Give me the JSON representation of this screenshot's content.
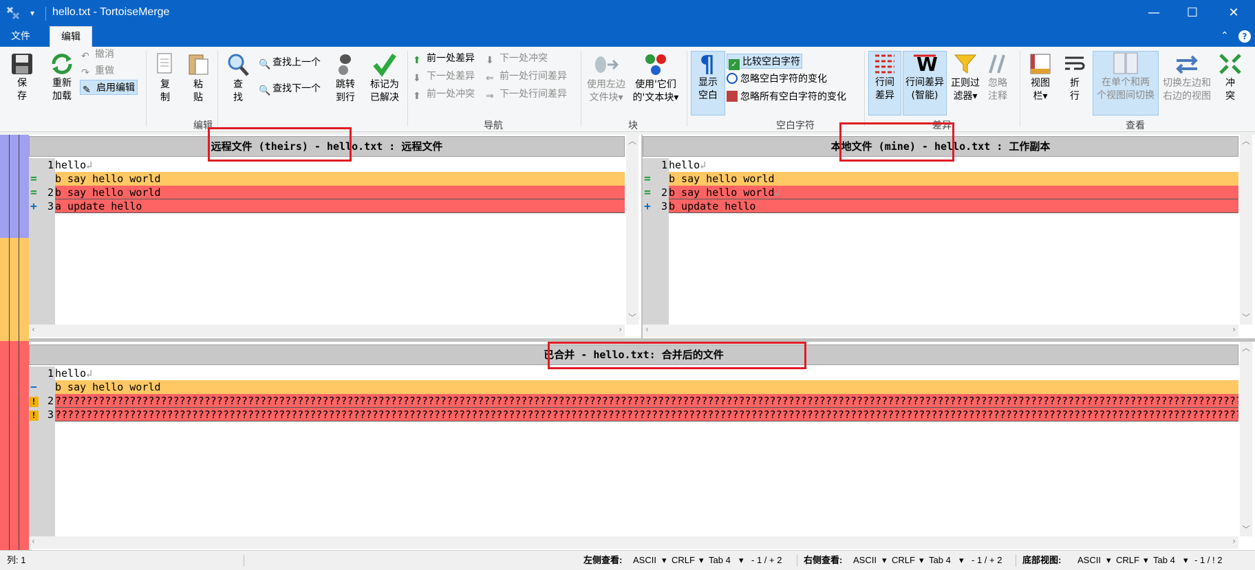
{
  "window": {
    "title": "hello.txt - TortoiseMerge",
    "minimize": "—",
    "maximize": "☐",
    "close": "✕"
  },
  "menu": {
    "file": "文件",
    "edit": "编辑"
  },
  "ribbon": {
    "edit_group": {
      "label": "编辑",
      "save": [
        "保",
        "存"
      ],
      "reload": [
        "重新",
        "加载"
      ],
      "undo": "撤消",
      "redo": "重做",
      "enable_edit": "启用编辑",
      "copy": [
        "复",
        "制"
      ],
      "paste": [
        "粘",
        "贴"
      ],
      "find": [
        "查",
        "找"
      ],
      "find_prev": "查找上一个",
      "find_next": "查找下一个",
      "goto_line": [
        "跳转",
        "到行"
      ],
      "mark_resolved": [
        "标记为",
        "已解决"
      ]
    },
    "nav_group": {
      "label": "导航",
      "prev_diff": "前一处差异",
      "next_diff": "下一处差异",
      "prev_conflict": "前一处冲突",
      "next_conflict": "下一处冲突",
      "prev_inline": "前一处行间差异",
      "next_inline": "下一处行间差异"
    },
    "block_group": {
      "label": "块",
      "use_left": [
        "使用左边",
        "文件块"
      ],
      "use_theirs": [
        "使用'它们",
        "的'文本块"
      ]
    },
    "ws_group": {
      "label": "空白字符",
      "show_ws": [
        "显示",
        "空白"
      ],
      "compare_ws": "比较空白字符",
      "ignore_ws_changes": "忽略空白字符的变化",
      "ignore_all_ws": "忽略所有空白字符的变化"
    },
    "diff_group": {
      "label": "差异",
      "inline_diff": [
        "行间",
        "差异"
      ],
      "inline_diff_smart": [
        "行间差异",
        "(智能)"
      ],
      "regex_filter": [
        "正则过",
        "滤器"
      ],
      "ignore_comments": [
        "忽略",
        "注释"
      ]
    },
    "view_group": {
      "label": "查看",
      "view_bar": [
        "视图",
        "栏"
      ],
      "wrap": [
        "折",
        "行"
      ],
      "single_two_view": [
        "在单个和两",
        "个视图间切换"
      ],
      "swap_views": [
        "切换左边和",
        "右边的视图"
      ],
      "conflict": [
        "冲",
        "突"
      ]
    }
  },
  "panes": {
    "theirs": {
      "header_name": "远程文件 (theirs)",
      "header_rest": " - hello.txt : 远程文件",
      "lines": [
        {
          "num": "1",
          "mark": "",
          "text": "hello",
          "style": "normal",
          "eol": "↲"
        },
        {
          "num": "",
          "mark": "=",
          "text": "b say hello world",
          "style": "orange",
          "eol": ""
        },
        {
          "num": "2",
          "mark": "=",
          "text": "b say hello world",
          "style": "red",
          "eol": ""
        },
        {
          "num": "3",
          "mark": "+",
          "text": "a update hello",
          "style": "red",
          "eol": ""
        }
      ]
    },
    "mine": {
      "header_name": "本地文件 (mine)",
      "header_rest": " - hello.txt : 工作副本",
      "lines": [
        {
          "num": "1",
          "mark": "",
          "text": "hello",
          "style": "normal",
          "eol": "↲"
        },
        {
          "num": "",
          "mark": "=",
          "text": "b say hello world",
          "style": "orange",
          "eol": ""
        },
        {
          "num": "2",
          "mark": "=",
          "text": "b say hello world",
          "style": "red",
          "eol": "↲"
        },
        {
          "num": "3",
          "mark": "+",
          "text": "b update hello",
          "style": "red",
          "eol": ""
        }
      ]
    },
    "merged": {
      "header_name": "已合并",
      "header_rest": " - hello.txt: 合并后的文件",
      "lines": [
        {
          "num": "1",
          "mark": "",
          "text": "hello",
          "style": "normal",
          "eol": "↲"
        },
        {
          "num": "",
          "mark": "−",
          "text": "b say hello world",
          "style": "orange",
          "eol": ""
        },
        {
          "num": "2",
          "mark": "!",
          "text": "???????????????????????????????????????????????????????????????????????????????????????????????????????????????????????????????????????????????????????????????????????????????????????????????????",
          "style": "red",
          "eol": ""
        },
        {
          "num": "3",
          "mark": "!",
          "text": "???????????????????????????????????????????????????????????????????????????????????????????????????????????????????????????????????????????????????????????????????????????????????????????????",
          "style": "red",
          "eol": ""
        }
      ]
    }
  },
  "status": {
    "col": "列: 1",
    "left_view": "左侧查看:",
    "left_enc": "ASCII",
    "left_eol": "CRLF",
    "left_tab": "Tab 4",
    "left_diff": "- 1 / + 2",
    "right_view": "右侧查看:",
    "right_enc": "ASCII",
    "right_eol": "CRLF",
    "right_tab": "Tab 4",
    "right_diff": "- 1 / + 2",
    "bottom_view": "底部视图:",
    "bottom_enc": "ASCII",
    "bottom_eol": "CRLF",
    "bottom_tab": "Tab 4",
    "bottom_diff": "- 1 / ! 2"
  },
  "colors": {
    "titlebar": "#0a64c8",
    "diff_orange": "#ffc864",
    "diff_red": "#ff6464",
    "location_blue": "#a0a0f0"
  }
}
